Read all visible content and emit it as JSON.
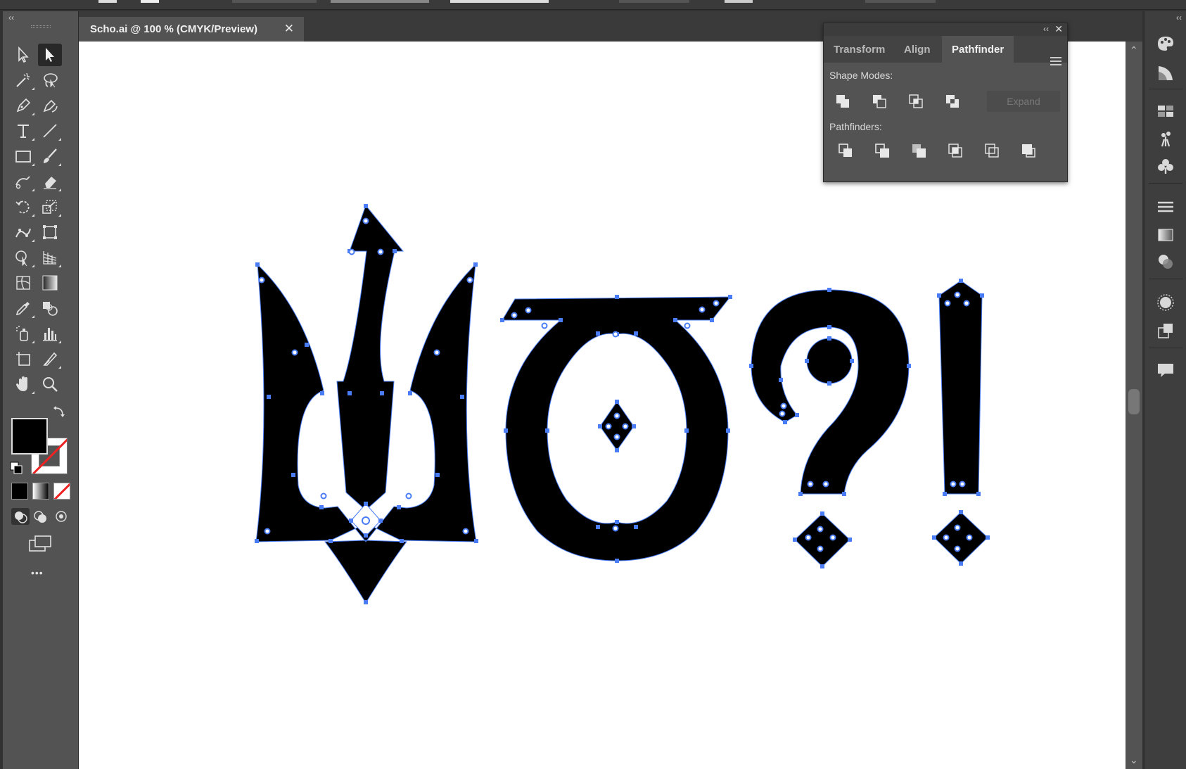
{
  "document": {
    "tab_title": "Scho.ai @ 100 % (CMYK/Preview)",
    "close_glyph": "✕"
  },
  "toolbar": {
    "collapse_glyph": "‹‹",
    "more_glyph": "•••",
    "tools": [
      "selection-tool",
      "direct-selection-tool",
      "magic-wand-tool",
      "lasso-tool",
      "pen-tool",
      "curvature-tool",
      "type-tool",
      "line-segment-tool",
      "rectangle-tool",
      "paintbrush-tool",
      "shaper-tool",
      "eraser-tool",
      "rotate-tool",
      "scale-tool",
      "puppet-warp-tool",
      "free-transform-tool",
      "shape-builder-tool",
      "perspective-grid-tool",
      "mesh-tool",
      "gradient-tool",
      "eyedropper-tool",
      "blend-tool",
      "symbol-sprayer-tool",
      "column-graph-tool",
      "artboard-tool",
      "slice-tool",
      "hand-tool",
      "zoom-tool"
    ],
    "active_tool": "direct-selection-tool",
    "fill_color": "#000000",
    "stroke": "none"
  },
  "panel": {
    "collapse_glyph": "‹‹",
    "close_glyph": "✕",
    "tabs": [
      {
        "label": "Transform",
        "active": false
      },
      {
        "label": "Align",
        "active": false
      },
      {
        "label": "Pathfinder",
        "active": true
      }
    ],
    "shape_modes_label": "Shape Modes:",
    "pathfinders_label": "Pathfinders:",
    "expand_label": "Expand",
    "shape_modes": [
      "unite-icon",
      "minus-front-icon",
      "intersect-icon",
      "exclude-icon"
    ],
    "pathfinders": [
      "divide-icon",
      "trim-icon",
      "merge-icon",
      "crop-icon",
      "outline-icon",
      "minus-back-icon"
    ]
  },
  "dock": {
    "collapse_glyph": "‹‹",
    "icons": [
      "color-palette-icon",
      "color-guide-icon",
      "swatches-icon",
      "brushes-icon",
      "symbols-icon",
      "stroke-icon",
      "gradient-icon",
      "transparency-icon",
      "appearance-icon",
      "graphic-styles-icon",
      "comments-icon"
    ]
  },
  "artwork": {
    "text": "Що?!",
    "fill": "#000000",
    "selection_color": "#4a7cf5"
  },
  "scrollbar": {
    "up_glyph": "⌃",
    "down_glyph": "⌄"
  }
}
